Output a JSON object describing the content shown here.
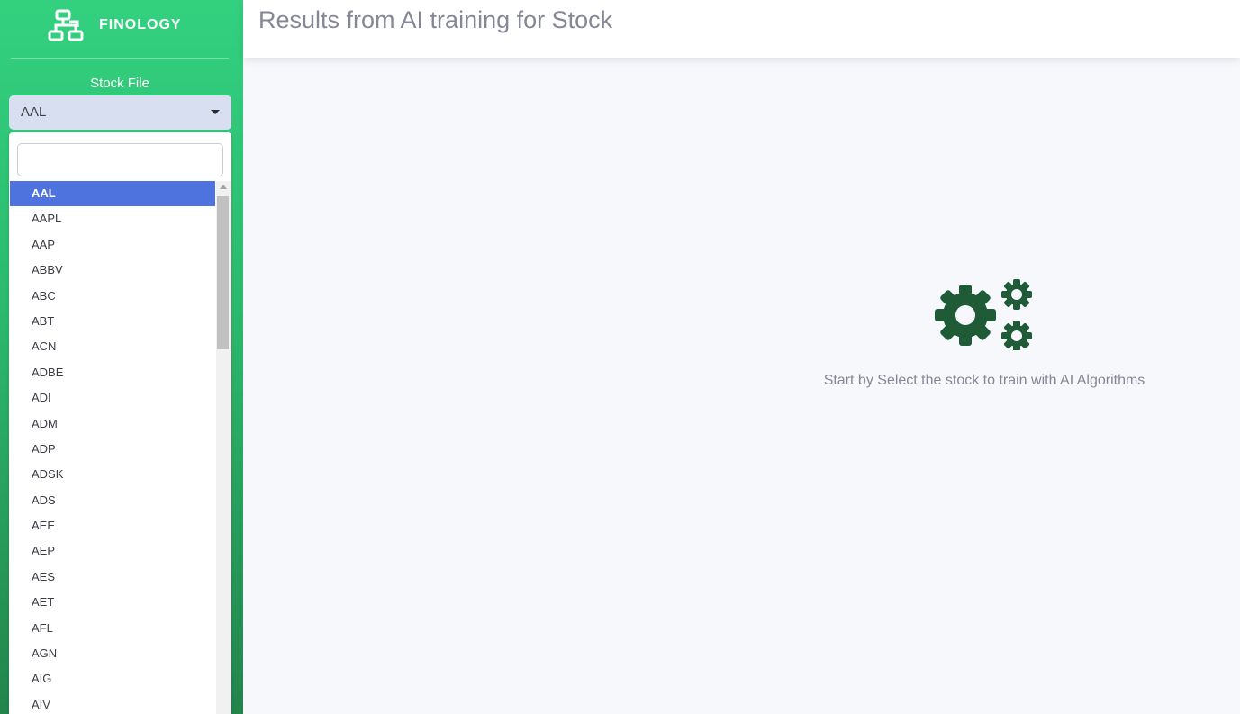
{
  "sidebar": {
    "brand": "FINOLOGY",
    "brand_icon": "sitemap-icon",
    "stock_label": "Stock File",
    "select": {
      "value": "AAL",
      "search_placeholder": "",
      "options": [
        "AAL",
        "AAPL",
        "AAP",
        "ABBV",
        "ABC",
        "ABT",
        "ACN",
        "ADBE",
        "ADI",
        "ADM",
        "ADP",
        "ADSK",
        "ADS",
        "AEE",
        "AEP",
        "AES",
        "AET",
        "AFL",
        "AGN",
        "AIG",
        "AIV"
      ],
      "selected_option": "AAL"
    }
  },
  "header": {
    "title": "Results from AI training for Stock"
  },
  "main": {
    "empty_icon": "cogs-icon",
    "empty_message": "Start by Select the stock to train with AI Algorithms",
    "icon_color": "#1f5b37"
  },
  "colors": {
    "sidebar_top": "#33d17f",
    "sidebar_bottom": "#23844c",
    "selected_option": "#4e73df"
  }
}
